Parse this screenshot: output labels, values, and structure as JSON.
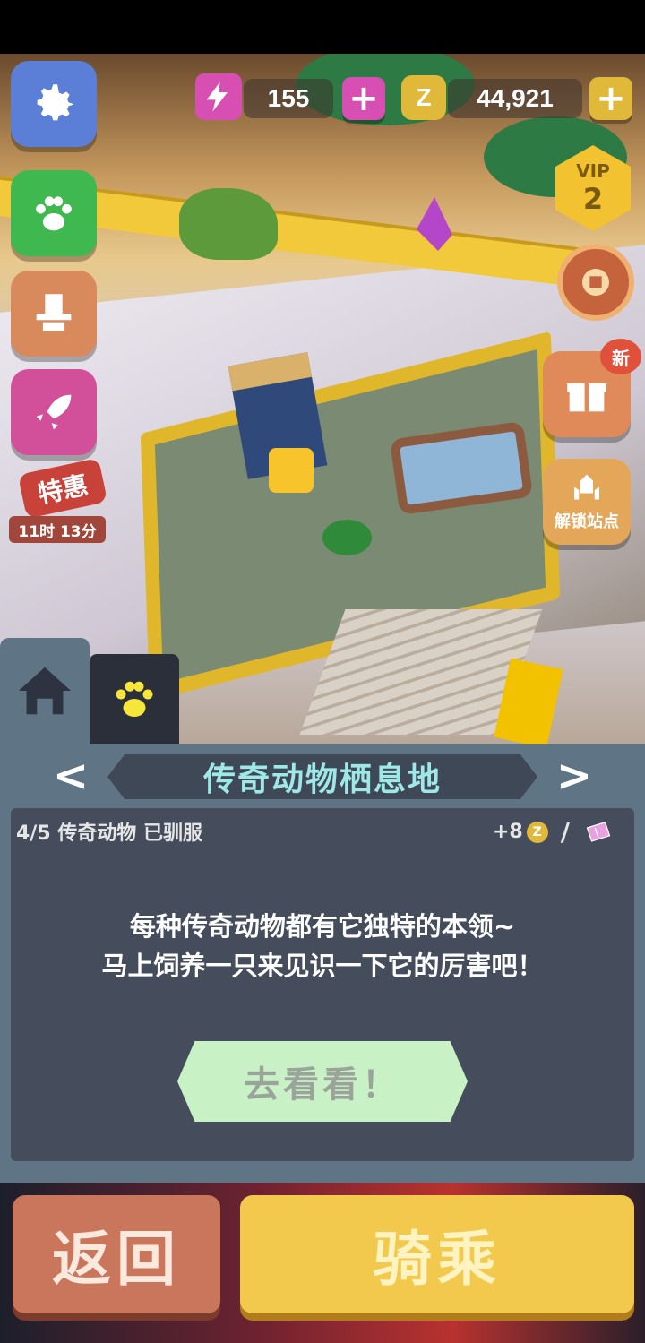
{
  "hud": {
    "energy_value": "155",
    "coins_value": "44,921",
    "plus_symbol": "+",
    "vip_label": "VIP",
    "vip_level": "2"
  },
  "side_left": {
    "deal_label": "特惠",
    "deal_timer": "11时 13分"
  },
  "side_right": {
    "gift_badge": "新",
    "unlock_label": "解锁站点"
  },
  "panel": {
    "title": "传奇动物栖息地",
    "prev_arrow": "<",
    "next_arrow": ">",
    "progress": "4/5 传奇动物 已驯服",
    "reward": "+8",
    "reward_separator": "/",
    "description_line1": "每种传奇动物都有它独特的本领~",
    "description_line2": "马上饲养一只来见识一下它的厉害吧！",
    "go_button": "去看看！"
  },
  "footer": {
    "back_button": "返回",
    "ride_button": "骑乘"
  },
  "colors": {
    "settings_bg": "#5b7fd6",
    "paw_bg": "#3fb94f",
    "hat_bg": "#d88a5c",
    "rocket_bg": "#d24f9a",
    "energy_bg": "#d84fb4",
    "coin_bg": "#e0b83a",
    "vip_bg": "#f2c230",
    "gift_bg": "#e08a5a",
    "unlock_bg": "#e4a75a",
    "panel_bg": "#5f7484",
    "title_text": "#9fe8e8",
    "go_button_bg": "#c9f1c6",
    "back_button_bg": "#c9765c",
    "ride_button_bg": "#f2c94c"
  }
}
